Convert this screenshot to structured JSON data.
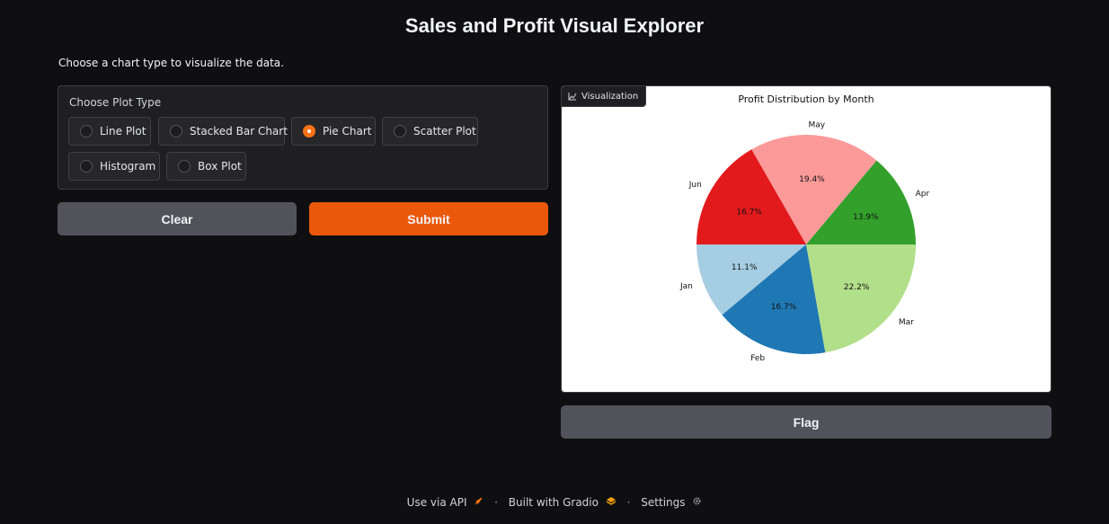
{
  "header": {
    "title": "Sales and Profit Visual Explorer",
    "description": "Choose a chart type to visualize the data."
  },
  "plot_type": {
    "label": "Choose Plot Type",
    "options": [
      "Line Plot",
      "Stacked Bar Chart",
      "Pie Chart",
      "Scatter Plot",
      "Histogram",
      "Box Plot"
    ],
    "selected": "Pie Chart"
  },
  "buttons": {
    "clear": "Clear",
    "submit": "Submit",
    "flag": "Flag"
  },
  "colors": {
    "accent": "#ea580c",
    "button_secondary": "#52525b",
    "background": "#0f0f11"
  },
  "visualization": {
    "label": "Visualization",
    "icon": "chart-icon"
  },
  "chart_data": {
    "type": "pie",
    "title": "Profit Distribution by Month",
    "categories": [
      "Jan",
      "Feb",
      "Mar",
      "Apr",
      "May",
      "Jun"
    ],
    "values": [
      11.1,
      16.7,
      22.2,
      13.9,
      19.4,
      16.7
    ],
    "labels_pct": [
      "11.1%",
      "16.7%",
      "22.2%",
      "13.9%",
      "19.4%",
      "16.7%"
    ],
    "colors": [
      "#a6cee3",
      "#1f78b4",
      "#b2df8a",
      "#33a02c",
      "#fb9a99",
      "#e31a1c"
    ],
    "start_angle": 180,
    "direction": "counterclockwise"
  },
  "footer": {
    "api": "Use via API",
    "built": "Built with Gradio",
    "settings": "Settings"
  }
}
